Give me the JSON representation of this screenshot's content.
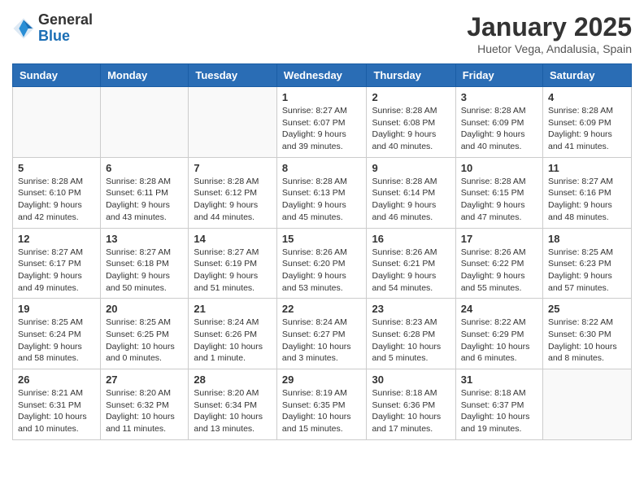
{
  "logo": {
    "general": "General",
    "blue": "Blue"
  },
  "title": "January 2025",
  "location": "Huetor Vega, Andalusia, Spain",
  "weekdays": [
    "Sunday",
    "Monday",
    "Tuesday",
    "Wednesday",
    "Thursday",
    "Friday",
    "Saturday"
  ],
  "weeks": [
    [
      {
        "day": "",
        "info": ""
      },
      {
        "day": "",
        "info": ""
      },
      {
        "day": "",
        "info": ""
      },
      {
        "day": "1",
        "info": "Sunrise: 8:27 AM\nSunset: 6:07 PM\nDaylight: 9 hours and 39 minutes."
      },
      {
        "day": "2",
        "info": "Sunrise: 8:28 AM\nSunset: 6:08 PM\nDaylight: 9 hours and 40 minutes."
      },
      {
        "day": "3",
        "info": "Sunrise: 8:28 AM\nSunset: 6:09 PM\nDaylight: 9 hours and 40 minutes."
      },
      {
        "day": "4",
        "info": "Sunrise: 8:28 AM\nSunset: 6:09 PM\nDaylight: 9 hours and 41 minutes."
      }
    ],
    [
      {
        "day": "5",
        "info": "Sunrise: 8:28 AM\nSunset: 6:10 PM\nDaylight: 9 hours and 42 minutes."
      },
      {
        "day": "6",
        "info": "Sunrise: 8:28 AM\nSunset: 6:11 PM\nDaylight: 9 hours and 43 minutes."
      },
      {
        "day": "7",
        "info": "Sunrise: 8:28 AM\nSunset: 6:12 PM\nDaylight: 9 hours and 44 minutes."
      },
      {
        "day": "8",
        "info": "Sunrise: 8:28 AM\nSunset: 6:13 PM\nDaylight: 9 hours and 45 minutes."
      },
      {
        "day": "9",
        "info": "Sunrise: 8:28 AM\nSunset: 6:14 PM\nDaylight: 9 hours and 46 minutes."
      },
      {
        "day": "10",
        "info": "Sunrise: 8:28 AM\nSunset: 6:15 PM\nDaylight: 9 hours and 47 minutes."
      },
      {
        "day": "11",
        "info": "Sunrise: 8:27 AM\nSunset: 6:16 PM\nDaylight: 9 hours and 48 minutes."
      }
    ],
    [
      {
        "day": "12",
        "info": "Sunrise: 8:27 AM\nSunset: 6:17 PM\nDaylight: 9 hours and 49 minutes."
      },
      {
        "day": "13",
        "info": "Sunrise: 8:27 AM\nSunset: 6:18 PM\nDaylight: 9 hours and 50 minutes."
      },
      {
        "day": "14",
        "info": "Sunrise: 8:27 AM\nSunset: 6:19 PM\nDaylight: 9 hours and 51 minutes."
      },
      {
        "day": "15",
        "info": "Sunrise: 8:26 AM\nSunset: 6:20 PM\nDaylight: 9 hours and 53 minutes."
      },
      {
        "day": "16",
        "info": "Sunrise: 8:26 AM\nSunset: 6:21 PM\nDaylight: 9 hours and 54 minutes."
      },
      {
        "day": "17",
        "info": "Sunrise: 8:26 AM\nSunset: 6:22 PM\nDaylight: 9 hours and 55 minutes."
      },
      {
        "day": "18",
        "info": "Sunrise: 8:25 AM\nSunset: 6:23 PM\nDaylight: 9 hours and 57 minutes."
      }
    ],
    [
      {
        "day": "19",
        "info": "Sunrise: 8:25 AM\nSunset: 6:24 PM\nDaylight: 9 hours and 58 minutes."
      },
      {
        "day": "20",
        "info": "Sunrise: 8:25 AM\nSunset: 6:25 PM\nDaylight: 10 hours and 0 minutes."
      },
      {
        "day": "21",
        "info": "Sunrise: 8:24 AM\nSunset: 6:26 PM\nDaylight: 10 hours and 1 minute."
      },
      {
        "day": "22",
        "info": "Sunrise: 8:24 AM\nSunset: 6:27 PM\nDaylight: 10 hours and 3 minutes."
      },
      {
        "day": "23",
        "info": "Sunrise: 8:23 AM\nSunset: 6:28 PM\nDaylight: 10 hours and 5 minutes."
      },
      {
        "day": "24",
        "info": "Sunrise: 8:22 AM\nSunset: 6:29 PM\nDaylight: 10 hours and 6 minutes."
      },
      {
        "day": "25",
        "info": "Sunrise: 8:22 AM\nSunset: 6:30 PM\nDaylight: 10 hours and 8 minutes."
      }
    ],
    [
      {
        "day": "26",
        "info": "Sunrise: 8:21 AM\nSunset: 6:31 PM\nDaylight: 10 hours and 10 minutes."
      },
      {
        "day": "27",
        "info": "Sunrise: 8:20 AM\nSunset: 6:32 PM\nDaylight: 10 hours and 11 minutes."
      },
      {
        "day": "28",
        "info": "Sunrise: 8:20 AM\nSunset: 6:34 PM\nDaylight: 10 hours and 13 minutes."
      },
      {
        "day": "29",
        "info": "Sunrise: 8:19 AM\nSunset: 6:35 PM\nDaylight: 10 hours and 15 minutes."
      },
      {
        "day": "30",
        "info": "Sunrise: 8:18 AM\nSunset: 6:36 PM\nDaylight: 10 hours and 17 minutes."
      },
      {
        "day": "31",
        "info": "Sunrise: 8:18 AM\nSunset: 6:37 PM\nDaylight: 10 hours and 19 minutes."
      },
      {
        "day": "",
        "info": ""
      }
    ]
  ]
}
